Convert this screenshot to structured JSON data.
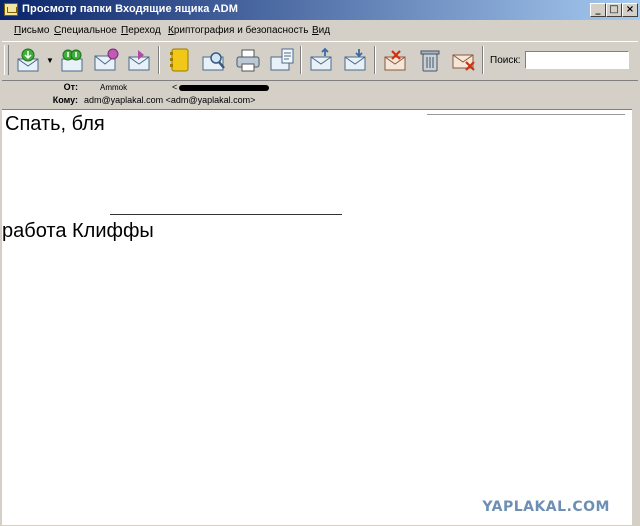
{
  "window": {
    "title": "Просмотр папки Входящие ящика ADM"
  },
  "menu": [
    {
      "label": "Письмо",
      "underline": "П",
      "rest": "исьмо"
    },
    {
      "label": "Специальное",
      "underline": "С",
      "rest": "пециальное"
    },
    {
      "label": "Переход",
      "underline": "П",
      "rest": "ереход"
    },
    {
      "label": "Криптография и безопасность",
      "underline": "К",
      "rest": "риптография и безопасность"
    },
    {
      "label": "Вид",
      "underline": "В",
      "rest": "ид"
    }
  ],
  "toolbar": {
    "search_label": "Поиск:",
    "search_value": "",
    "icons": [
      "receive-mail-icon",
      "receive-all-icon",
      "new-message-icon",
      "reply-icon",
      "address-book-icon",
      "find-icon",
      "print-icon",
      "properties-icon",
      "previous-message-icon",
      "next-message-icon",
      "mark-read-icon",
      "delete-icon",
      "delete-read-icon"
    ]
  },
  "header": {
    "from_label": "От:",
    "from_name": "Ammok",
    "from_email_open": "<",
    "to_label": "Кому:",
    "to_value": "adm@yaplakal.com <adm@yaplakal.com>"
  },
  "body": {
    "line1": "Спать, бля",
    "line2": "работа Клиффы"
  },
  "watermark": "YAPLAKAL.COM"
}
